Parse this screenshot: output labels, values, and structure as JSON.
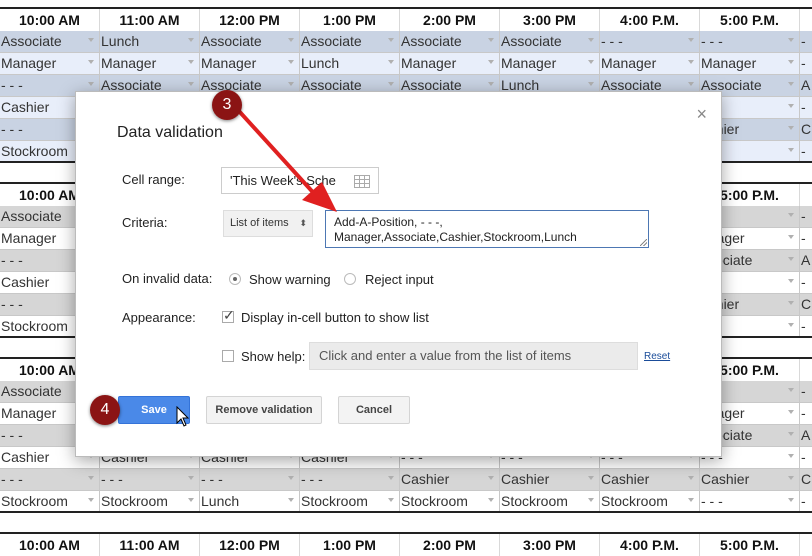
{
  "spreadsheet": {
    "time_headers": [
      "10:00 AM",
      "11:00 AM",
      "12:00 PM",
      "1:00 PM",
      "2:00 PM",
      "3:00 PM",
      "4:00 P.M.",
      "5:00 P.M."
    ],
    "block1_rows": [
      [
        "Associate",
        "Lunch",
        "Associate",
        "Associate",
        "Associate",
        "Associate",
        "- - -",
        "- - -",
        "-"
      ],
      [
        "Manager",
        "Manager",
        "Manager",
        "Lunch",
        "Manager",
        "Manager",
        "Manager",
        "Manager",
        "-"
      ],
      [
        "- - -",
        "Associate",
        "Associate",
        "Associate",
        "Associate",
        "Lunch",
        "Associate",
        "Associate",
        "A"
      ],
      [
        "Cashier",
        "",
        "",
        "",
        "",
        "",
        "",
        "- -",
        "-"
      ],
      [
        "- - -",
        "",
        "",
        "",
        "",
        "",
        "",
        "ashier",
        "C"
      ],
      [
        "Stockroom",
        "",
        "",
        "",
        "",
        "",
        "",
        "- -",
        "-"
      ]
    ],
    "block2_rows": [
      [
        "Associate",
        "",
        "",
        "",
        "",
        "",
        "",
        "- -",
        "-"
      ],
      [
        "Manager",
        "",
        "",
        "",
        "",
        "",
        "",
        "anager",
        "-"
      ],
      [
        "- - -",
        "",
        "",
        "",
        "",
        "",
        "",
        "ssociate",
        "A"
      ],
      [
        "Cashier",
        "",
        "",
        "",
        "",
        "",
        "",
        "- -",
        "-"
      ],
      [
        "- - -",
        "",
        "",
        "",
        "",
        "",
        "",
        "ashier",
        "C"
      ],
      [
        "Stockroom",
        "",
        "",
        "",
        "",
        "",
        "",
        "- -",
        "-"
      ]
    ],
    "block3_rows": [
      [
        "Associate",
        "",
        "",
        "",
        "",
        "",
        "",
        "- -",
        "-"
      ],
      [
        "Manager",
        "",
        "",
        "",
        "",
        "",
        "",
        "anager",
        "-"
      ],
      [
        "- - -",
        "",
        "",
        "",
        "",
        "",
        "",
        "ssociate",
        "A"
      ],
      [
        "Cashier",
        "Cashier",
        "Cashier",
        "Cashier",
        "- - -",
        "- - -",
        "- - -",
        "- - -",
        "-"
      ],
      [
        "- - -",
        "- - -",
        "- - -",
        "- - -",
        "Cashier",
        "Cashier",
        "Cashier",
        "Cashier",
        "C"
      ],
      [
        "Stockroom",
        "Stockroom",
        "Lunch",
        "Stockroom",
        "Stockroom",
        "Stockroom",
        "Stockroom",
        "- - -",
        "-"
      ]
    ]
  },
  "dialog": {
    "title": "Data validation",
    "close_icon": "×",
    "cell_range_label": "Cell range:",
    "cell_range_value": "'This Week's Sche",
    "criteria_label": "Criteria:",
    "criteria_type": "List of items",
    "criteria_type_arrow": "⬍",
    "criteria_values": "Add-A-Position, - - -, Manager,Associate,Cashier,Stockroom,Lunch",
    "criteria_line1": "Add-A-Position, - - -,",
    "criteria_line2": "Manager,Associate,Cashier,Stockroom,Lunch",
    "invalid_label": "On invalid data:",
    "invalid_options": [
      {
        "label": "Show warning",
        "selected": true
      },
      {
        "label": "Reject input",
        "selected": false
      }
    ],
    "appearance_label": "Appearance:",
    "display_button_label": "Display in-cell button to show list",
    "display_button_checked": true,
    "show_help_label": "Show help:",
    "show_help_checked": false,
    "help_placeholder": "Click and enter a value from the list of items",
    "reset_label": "Reset",
    "save_label": "Save",
    "remove_label": "Remove validation",
    "cancel_label": "Cancel"
  },
  "annotations": {
    "step3": "3",
    "step4": "4",
    "arrow_color": "#e02020",
    "badge_color": "#8b1414"
  }
}
